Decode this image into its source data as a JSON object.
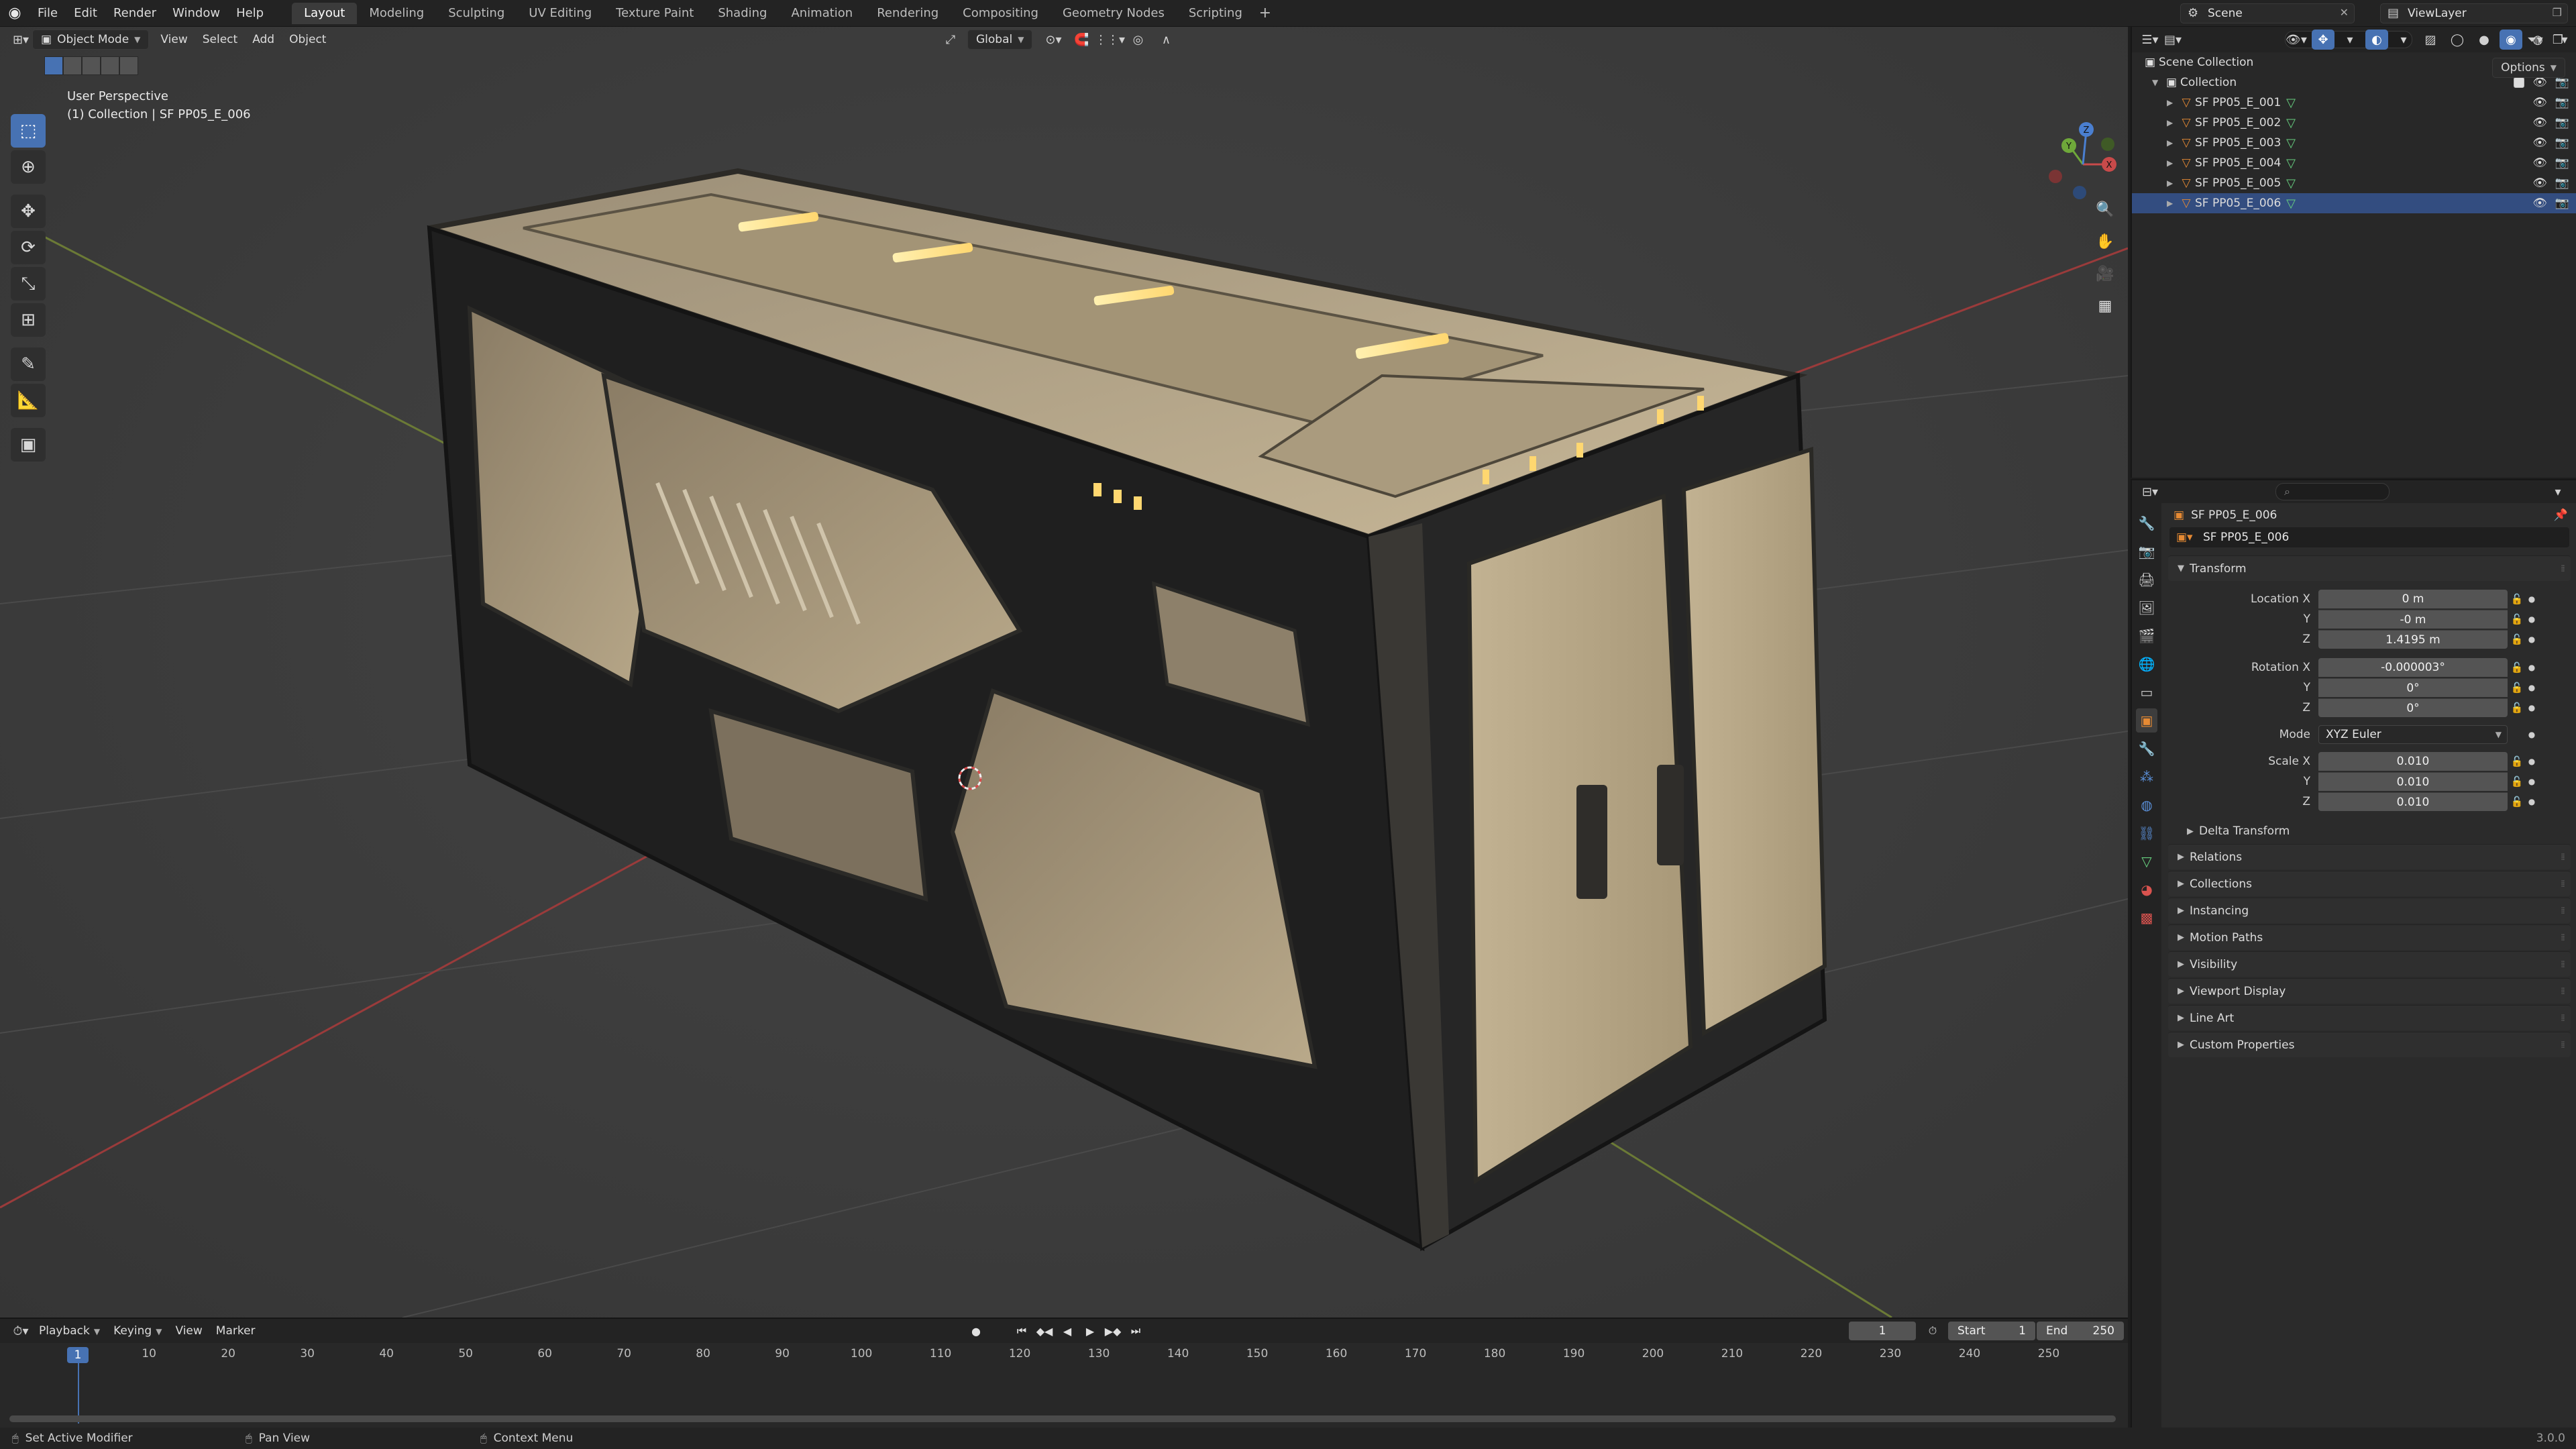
{
  "menu": {
    "items": [
      "File",
      "Edit",
      "Render",
      "Window",
      "Help"
    ]
  },
  "workspaces": {
    "tabs": [
      "Layout",
      "Modeling",
      "Sculpting",
      "UV Editing",
      "Texture Paint",
      "Shading",
      "Animation",
      "Rendering",
      "Compositing",
      "Geometry Nodes",
      "Scripting"
    ],
    "active": "Layout",
    "add": "+"
  },
  "scene": {
    "name": "Scene"
  },
  "view_layer": {
    "name": "ViewLayer"
  },
  "viewport_header": {
    "mode": "Object Mode",
    "menus": [
      "View",
      "Select",
      "Add",
      "Object"
    ],
    "transform_orientation": "Global",
    "options": "Options"
  },
  "viewport": {
    "perspective": "User Perspective",
    "context": "(1) Collection | SF PP05_E_006",
    "gizmo_axes": [
      "X",
      "Y",
      "Z"
    ]
  },
  "outliner": {
    "root": "Scene Collection",
    "collection": "Collection",
    "objects": [
      "SF PP05_E_001",
      "SF PP05_E_002",
      "SF PP05_E_003",
      "SF PP05_E_004",
      "SF PP05_E_005",
      "SF PP05_E_006"
    ],
    "selected_index": 5
  },
  "properties": {
    "object_name": "SF PP05_E_006",
    "object_field": "SF PP05_E_006",
    "transform": {
      "title": "Transform",
      "location_label": "Location X",
      "location": [
        "0 m",
        "-0 m",
        "1.4195 m"
      ],
      "rotation_label": "Rotation X",
      "rotation": [
        "-0.000003°",
        "0°",
        "0°"
      ],
      "mode_label": "Mode",
      "mode": "XYZ Euler",
      "scale_label": "Scale X",
      "scale": [
        "0.010",
        "0.010",
        "0.010"
      ],
      "axis_y": "Y",
      "axis_z": "Z",
      "delta": "Delta Transform"
    },
    "panels": [
      "Relations",
      "Collections",
      "Instancing",
      "Motion Paths",
      "Visibility",
      "Viewport Display",
      "Line Art",
      "Custom Properties"
    ]
  },
  "timeline": {
    "menus": [
      "Playback",
      "Keying",
      "View",
      "Marker"
    ],
    "current_frame": "1",
    "start_label": "Start",
    "start": "1",
    "end_label": "End",
    "end": "250",
    "ruler": [
      "1",
      "10",
      "20",
      "30",
      "40",
      "50",
      "60",
      "70",
      "80",
      "90",
      "100",
      "110",
      "120",
      "130",
      "140",
      "150",
      "160",
      "170",
      "180",
      "190",
      "200",
      "210",
      "220",
      "230",
      "240",
      "250"
    ]
  },
  "statusbar": {
    "left": "Set Active Modifier",
    "middle": "Pan View",
    "right": "Context Menu",
    "version": "3.0.0"
  },
  "colors": {
    "accent": "#4772b3",
    "mesh_icon": "#e68a33",
    "data_icon": "#67d07f",
    "selected_row": "#334d80",
    "crate_paint": "#b5a58a",
    "crate_frame": "#2a2a2a"
  }
}
